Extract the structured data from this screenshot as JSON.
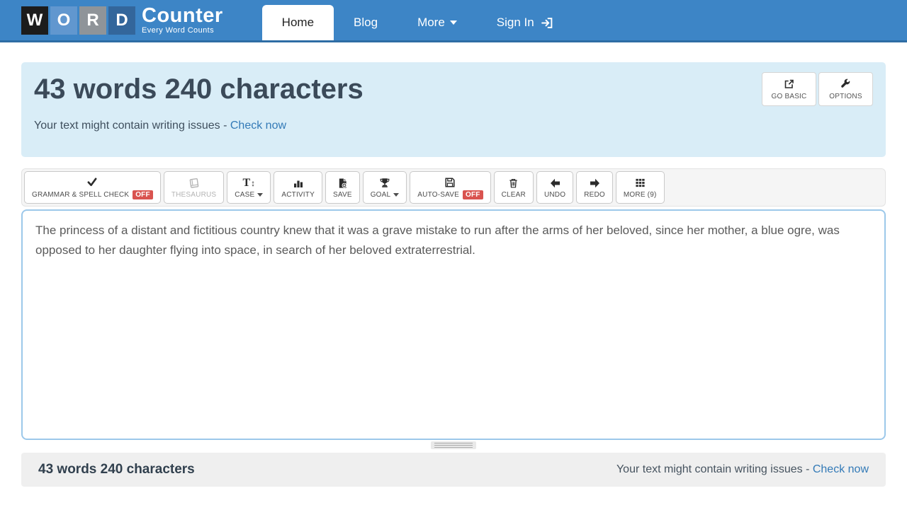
{
  "colors": {
    "nav_blue": "#3d85c6",
    "nav_border": "#2e6da4",
    "panel_bg": "#d9edf7",
    "link_blue": "#337ab7",
    "badge_red": "#d9534f",
    "heading_text": "#3b4a59",
    "textarea_border": "#9cc8ea"
  },
  "nav": {
    "logo": {
      "letters": [
        "W",
        "O",
        "R",
        "D"
      ],
      "letter_colors": [
        "#1c1c1c",
        "#6197cf",
        "#8f9499",
        "#33669b"
      ],
      "name": "Counter",
      "tagline": "Every Word Counts"
    },
    "items": [
      {
        "label": "Home",
        "active": true
      },
      {
        "label": "Blog"
      },
      {
        "label": "More",
        "caret": true
      },
      {
        "label": "Sign In",
        "icon": "sign-in"
      }
    ]
  },
  "header": {
    "title": "43 words 240 characters",
    "notice_text": "Your text might contain writing issues -",
    "notice_link": "Check now",
    "actions": [
      {
        "label": "GO BASIC",
        "icon": "external-link"
      },
      {
        "label": "OPTIONS",
        "icon": "wrench"
      }
    ]
  },
  "toolbar": {
    "buttons": [
      {
        "label": "GRAMMAR & SPELL CHECK",
        "icon": "check",
        "badge": "OFF"
      },
      {
        "label": "THESAURUS",
        "icon": "book",
        "disabled": true
      },
      {
        "label": "CASE",
        "icon": "case",
        "caret": true
      },
      {
        "label": "ACTIVITY",
        "icon": "bar-chart"
      },
      {
        "label": "SAVE",
        "icon": "save-file"
      },
      {
        "label": "GOAL",
        "icon": "trophy",
        "caret": true
      },
      {
        "label": "AUTO-SAVE",
        "icon": "floppy",
        "badge": "OFF"
      },
      {
        "label": "CLEAR",
        "icon": "trash"
      },
      {
        "label": "UNDO",
        "icon": "arrow-left"
      },
      {
        "label": "REDO",
        "icon": "arrow-right"
      },
      {
        "label": "MORE (9)",
        "icon": "grid"
      }
    ]
  },
  "editor": {
    "text": "The princess of a distant and fictitious country knew that it was a grave mistake to run after the arms of her beloved, since her mother, a blue ogre, was opposed to her daughter flying into space, in search of her beloved extraterrestrial."
  },
  "footer": {
    "stats": "43 words 240 characters",
    "notice_text": "Your text might contain writing issues -",
    "notice_link": "Check now"
  }
}
